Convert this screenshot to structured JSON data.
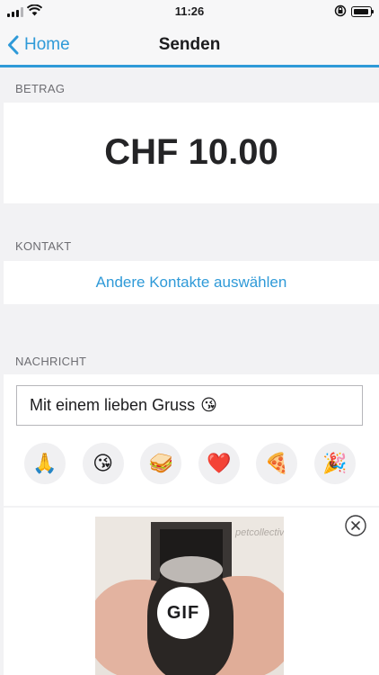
{
  "status_bar": {
    "time": "11:26"
  },
  "nav": {
    "back_label": "Home",
    "title": "Senden"
  },
  "amount_section": {
    "label": "BETRAG",
    "amount": "CHF 10.00"
  },
  "contact_section": {
    "label": "KONTAKT",
    "select_link": "Andere Kontakte auswählen"
  },
  "message_section": {
    "label": "NACHRICHT",
    "message_text": "Mit einem lieben Gruss",
    "message_emoji": "😘",
    "emojis": [
      "🙏",
      "😘",
      "🥪",
      "❤️",
      "🍕",
      "🎉"
    ]
  },
  "gif": {
    "badge": "GIF",
    "watermark": "petcollective"
  },
  "colors": {
    "accent": "#2f9ad8",
    "background": "#f2f2f4"
  }
}
